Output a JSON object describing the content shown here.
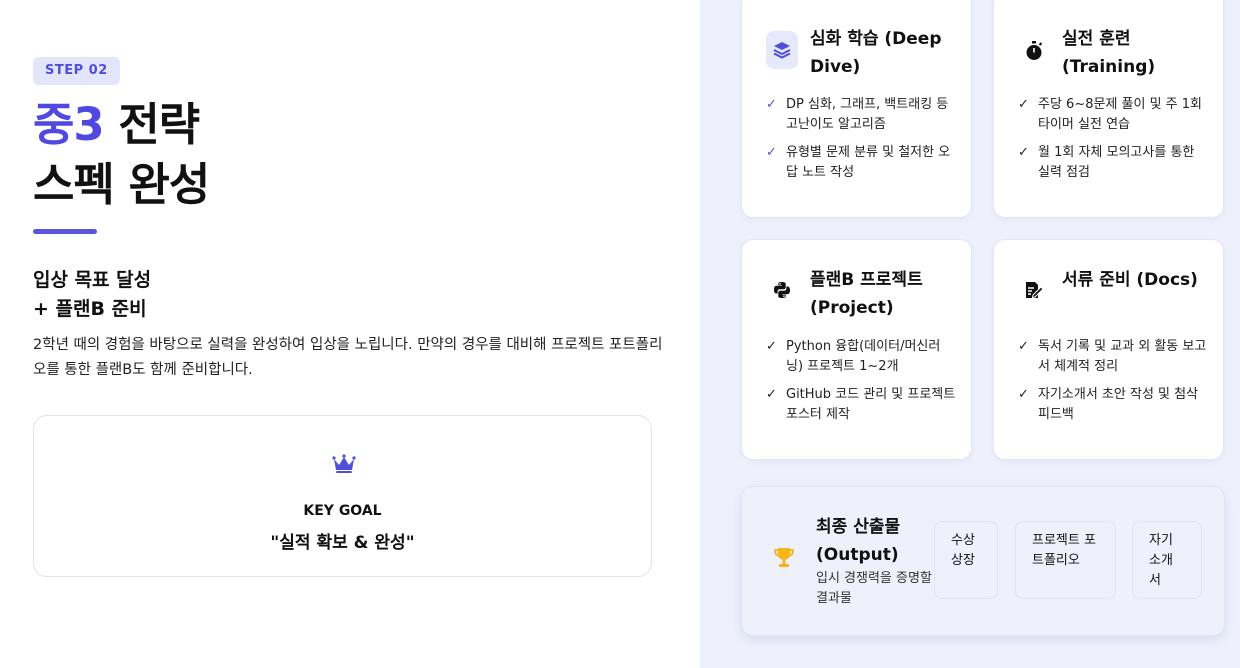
{
  "left": {
    "step_badge": "STEP 02",
    "headline_accent": "중3",
    "headline_rest": " 전략",
    "headline_line2": "스펙 완성",
    "subhead_line1": "입상 목표 달성",
    "subhead_line2": "+ 플랜B 준비",
    "description": "2학년 때의 경험을 바탕으로 실력을 완성하여 입상을 노립니다. 만약의 경우를 대비해 프로젝트 포트폴리오를 통한 플랜B도 함께 준비합니다.",
    "goal": {
      "icon": "crown-icon",
      "label": "KEY GOAL",
      "value": "\"실적 확보 & 완성\""
    }
  },
  "cards": [
    {
      "icon": "layers-icon",
      "title": "심화 학습 (Deep Dive)",
      "items": [
        "DP 심화, 그래프, 백트래킹 등 고난이도 알고리즘",
        "유형별 문제 분류 및 철저한 오답 노트 작성"
      ]
    },
    {
      "icon": "stopwatch-icon",
      "title": "실전 훈련 (Training)",
      "items": [
        "주당 6~8문제 풀이 및 주 1회 타이머 실전 연습",
        "월 1회 자체 모의고사를 통한 실력 점검"
      ]
    },
    {
      "icon": "python-icon",
      "title": "플랜B 프로젝트 (Project)",
      "items": [
        "Python 융합(데이터/머신러닝) 프로젝트 1~2개",
        "GitHub 코드 관리 및 프로젝트 포스터 제작"
      ]
    },
    {
      "icon": "document-edit-icon",
      "title": "서류 준비 (Docs)",
      "items": [
        "독서 기록 및 교과 외 활동 보고서 체계적 정리",
        "자기소개서 초안 작성 및 첨삭 피드백"
      ]
    }
  ],
  "output": {
    "icon": "trophy-icon",
    "title": "최종 산출물 (Output)",
    "subtitle": "입시 경쟁력을 증명할 결과물",
    "chips": [
      "수상 상장",
      "프로젝트 포트폴리오",
      "자기소개서"
    ]
  },
  "colors": {
    "accent": "#5048e0",
    "badge_bg": "#e3e6fb",
    "right_bg": "#eef1fc",
    "trophy": "#f5b417"
  }
}
